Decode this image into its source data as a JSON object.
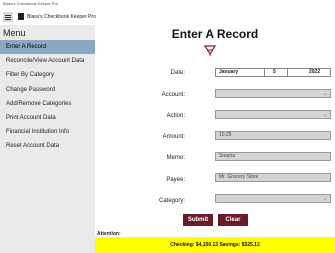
{
  "window": {
    "title": "Blass's Checkbook Keeper Pro"
  },
  "appbar": {
    "title": "Blass's Checkbook Keeper Pro"
  },
  "sidebar": {
    "heading": "Menu",
    "items": [
      {
        "label": "Enter A Record"
      },
      {
        "label": "Reconcile/View Account Data"
      },
      {
        "label": "Filter By Category"
      },
      {
        "label": "Change Password"
      },
      {
        "label": "Add/Remove Categories"
      },
      {
        "label": "Print Account Data"
      },
      {
        "label": "Financial Institution Info"
      },
      {
        "label": "Reset Account Data"
      }
    ]
  },
  "form": {
    "title": "Enter A Record",
    "date_label": "Date:",
    "date": {
      "month": "January",
      "day": "5",
      "year": "2022"
    },
    "account_label": "Account:",
    "account_value": "",
    "action_label": "Action:",
    "action_value": "",
    "amount_label": "Amount:",
    "amount_value": "10.25",
    "memo_label": "Memo:",
    "memo_value": "Snacks",
    "payee_label": "Payee:",
    "payee_value": "Mr. Grocery Store",
    "category_label": "Category:",
    "category_value": "",
    "submit_label": "Submit",
    "clear_label": "Clear"
  },
  "footer": {
    "attention_label": "Attention:",
    "balances": "Checking: $4,150.13  Savings: $525.12"
  },
  "colors": {
    "sidebar_active": "#8aa7c4",
    "button": "#6a1a2b",
    "status_bar": "#ffff00",
    "logo": "#8b1a2b"
  }
}
